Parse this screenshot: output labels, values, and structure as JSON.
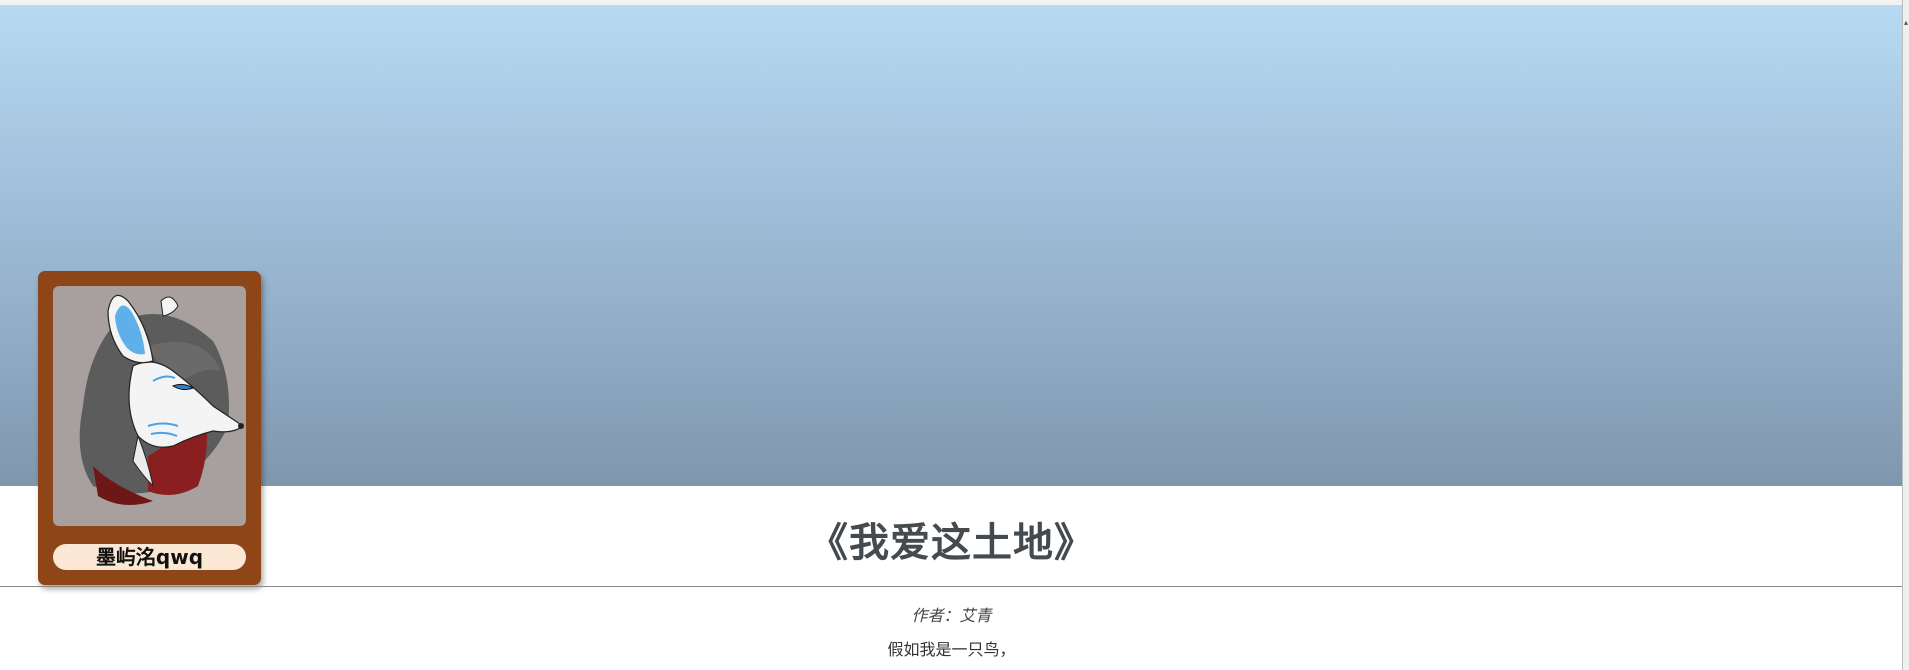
{
  "profile": {
    "username": "墨屿洺qwq",
    "avatar_icon": "hooded-wolf-avatar-icon"
  },
  "article": {
    "title": "《我爱这土地》",
    "author": "作者：艾青",
    "first_line": "假如我是一只鸟，"
  },
  "colors": {
    "banner_top": "#b7daf2",
    "banner_bottom": "#7f97ae",
    "card": "#8e4619",
    "pill": "#fbe9d6"
  }
}
